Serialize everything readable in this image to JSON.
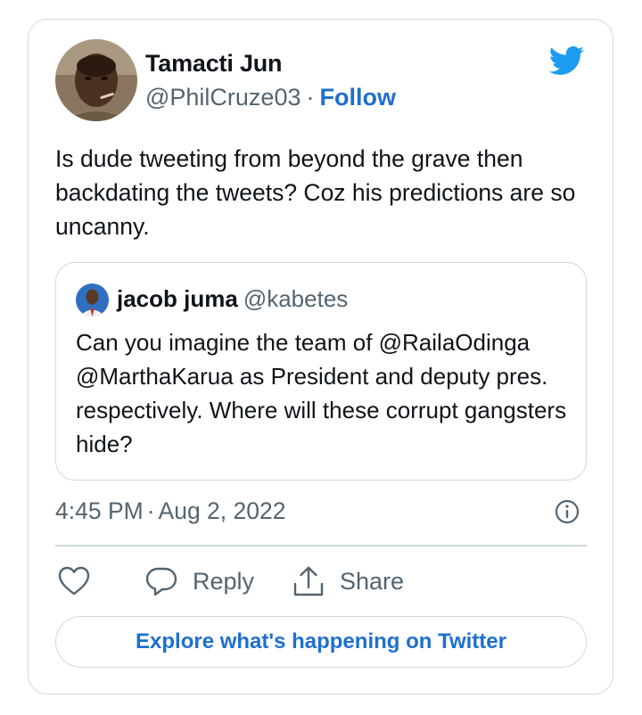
{
  "tweet": {
    "author": {
      "name": "Tamacti Jun",
      "handle": "@PhilCruze03",
      "separator": "·",
      "follow_label": "Follow"
    },
    "text": "Is dude tweeting from beyond the grave then backdating the tweets? Coz his predictions are so uncanny.",
    "quoted": {
      "name": "jacob juma",
      "handle": "@kabetes",
      "text": "Can you imagine the team of @RailaOdinga @MarthaKarua as President and deputy pres. respectively. Where will these corrupt gangsters hide?"
    },
    "time": "4:45 PM",
    "date_separator": "·",
    "date": "Aug 2, 2022"
  },
  "actions": {
    "like_icon": "heart-icon",
    "reply_label": "Reply",
    "share_label": "Share"
  },
  "explore_label": "Explore what's happening on Twitter",
  "colors": {
    "twitter_blue": "#1d9bf0",
    "link_blue": "#1d6fd1",
    "secondary_text": "#536471",
    "border": "#cfd9de"
  }
}
